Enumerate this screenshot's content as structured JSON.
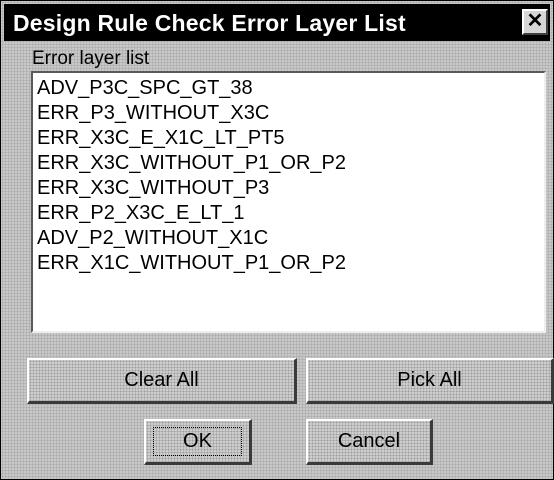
{
  "window": {
    "title": "Design Rule Check Error Layer List",
    "close_glyph": "✕"
  },
  "error_list": {
    "label": "Error layer list",
    "items": [
      "ADV_P3C_SPC_GT_38",
      "ERR_P3_WITHOUT_X3C",
      "ERR_X3C_E_X1C_LT_PT5",
      "ERR_X3C_WITHOUT_P1_OR_P2",
      "ERR_X3C_WITHOUT_P3",
      "ERR_P2_X3C_E_LT_1",
      "ADV_P2_WITHOUT_X1C",
      "ERR_X1C_WITHOUT_P1_OR_P2"
    ]
  },
  "buttons": {
    "clear_all": "Clear All",
    "pick_all": "Pick All",
    "ok": "OK",
    "cancel": "Cancel"
  },
  "colors": {
    "titlebar": "#000000",
    "title_text": "#ffffff",
    "dialog_face": "#c8c8c8",
    "list_background": "#ffffff"
  }
}
